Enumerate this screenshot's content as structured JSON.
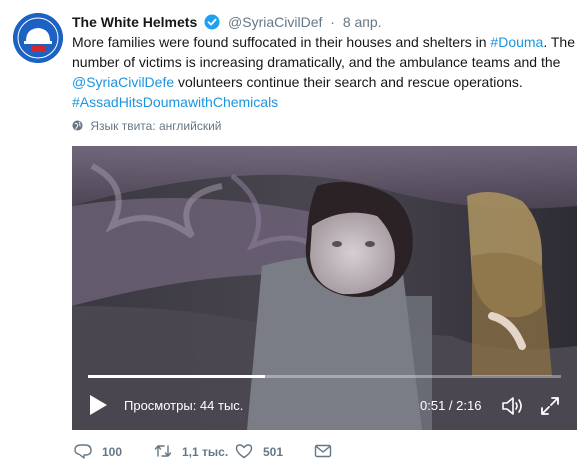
{
  "account": {
    "name": "The White Helmets",
    "handle": "@SyriaCivilDef",
    "separator": "·",
    "date": "8 апр."
  },
  "tweet": {
    "line1_text": "More families were found suffocated in their houses and shelters in ",
    "line1_hashtag": "#Douma",
    "line1_tail": ". The",
    "line2_text": "number of victims is increasing dramatically, and the ambulance teams and the",
    "line3_mention": "@SyriaCivilDefe",
    "line3_text": " volunteers continue their search and rescue operations.",
    "line4_hashtag": "#AssadHitsDoumawithChemicals"
  },
  "language_note": "Язык твита: английский",
  "video": {
    "views": "Просмотры: 44 тыс.",
    "time": "0:51 / 2:16",
    "progress": 0.375
  },
  "actions": {
    "replies": "100",
    "retweets": "1,1 тыс.",
    "likes": "501"
  },
  "colors": {
    "link": "#1b95e0",
    "verified": "#1da1f2",
    "muted": "#657786",
    "avatar_bg": "#1d62c2"
  },
  "icons": [
    "white-helmets-logo-icon",
    "verified-badge-icon",
    "globe-icon",
    "play-icon",
    "volume-icon",
    "fullscreen-icon",
    "reply-icon",
    "retweet-icon",
    "like-icon",
    "direct-message-icon"
  ]
}
